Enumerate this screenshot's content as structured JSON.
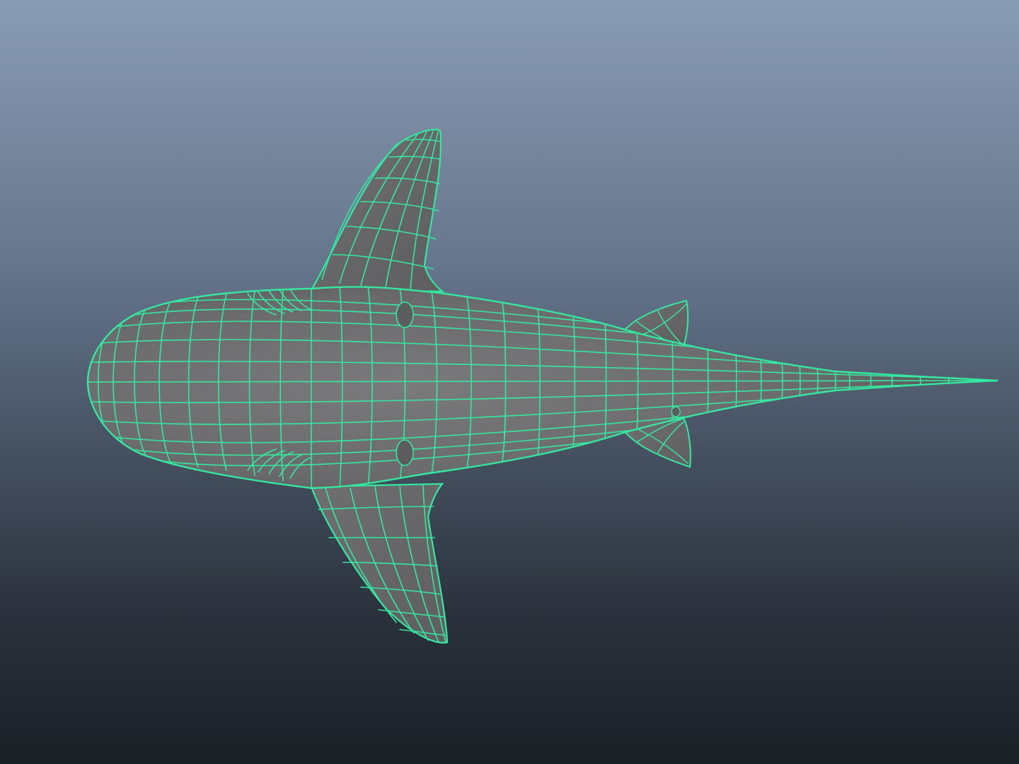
{
  "viewport": {
    "name": "3d-viewport",
    "view": "top",
    "display_mode": "wireframe-on-shaded"
  },
  "model": {
    "name": "shark",
    "surface_color": "#6e6e70",
    "wire_color": "#34e8a0"
  },
  "colors": {
    "background_top": "#8a9cb4",
    "background_bottom": "#1b1f26"
  }
}
